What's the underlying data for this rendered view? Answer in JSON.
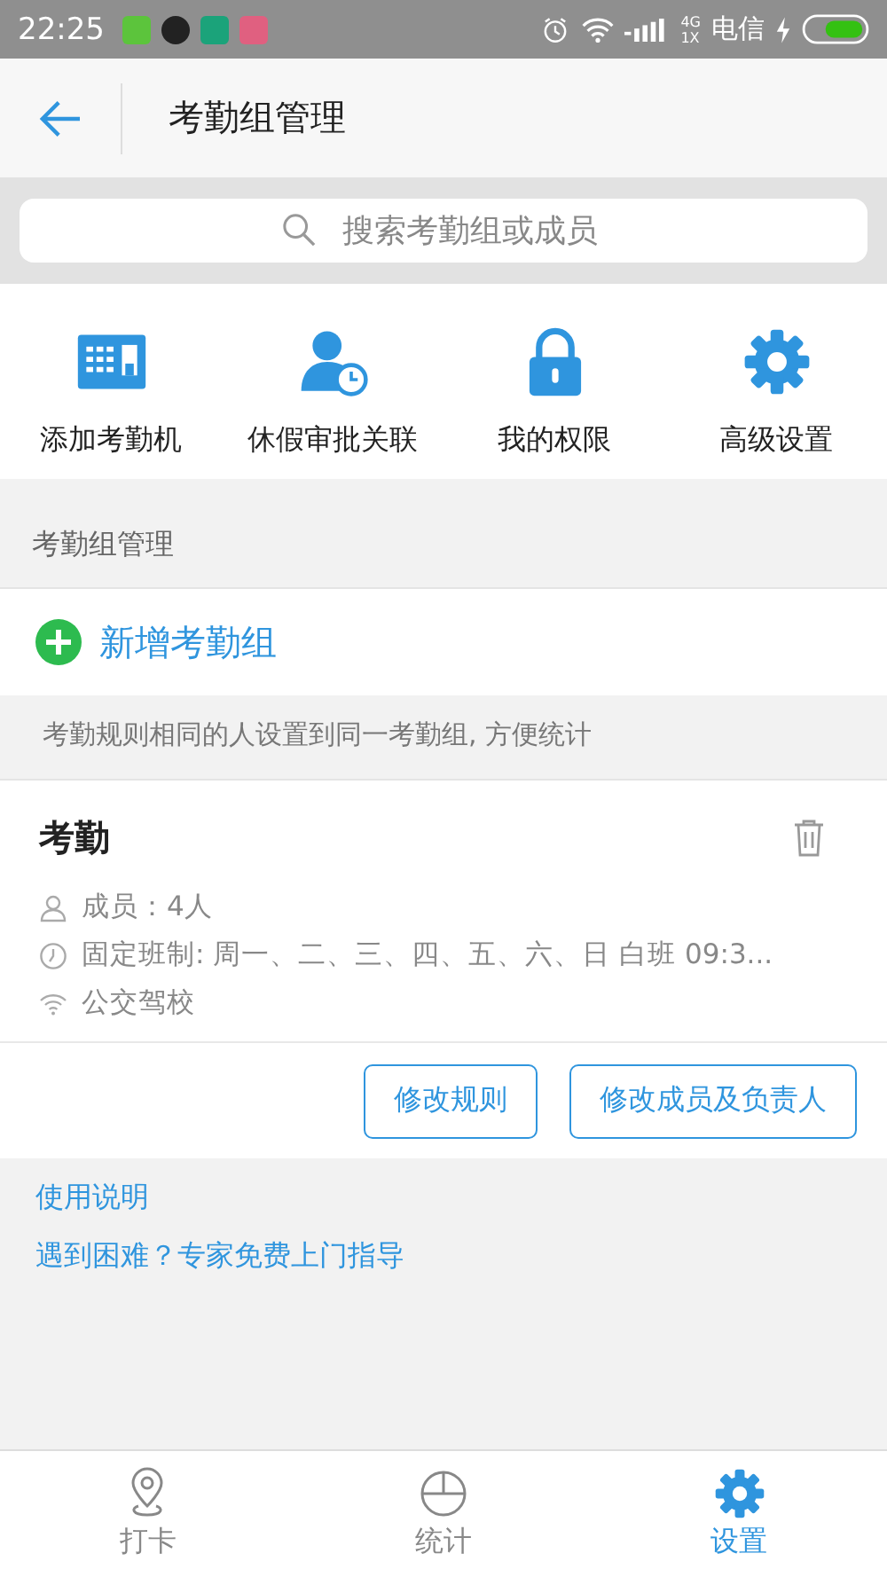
{
  "status_bar": {
    "time": "22:25",
    "network": [
      "4G",
      "1X"
    ],
    "carrier": "电信"
  },
  "header": {
    "title": "考勤组管理"
  },
  "search": {
    "placeholder": "搜索考勤组或成员"
  },
  "shortcuts": [
    {
      "kind": "device",
      "label": "添加考勤机"
    },
    {
      "kind": "person-clock",
      "label": "休假审批关联"
    },
    {
      "kind": "lock",
      "label": "我的权限"
    },
    {
      "kind": "gear",
      "label": "高级设置"
    }
  ],
  "section_title": "考勤组管理",
  "add_group": {
    "label": "新增考勤组"
  },
  "hint": "考勤规则相同的人设置到同一考勤组, 方便统计",
  "group": {
    "name": "考勤",
    "details": [
      {
        "kind": "members",
        "text": "成员：4人"
      },
      {
        "kind": "schedule",
        "text": "固定班制: 周一、二、三、四、五、六、日 白班 09:3..."
      },
      {
        "kind": "wifi",
        "text": "公交驾校"
      }
    ],
    "buttons": [
      "修改规则",
      "修改成员及负责人"
    ]
  },
  "links": [
    "使用说明",
    "遇到困难？专家免费上门指导"
  ],
  "tabs": [
    {
      "kind": "pin",
      "label": "打卡",
      "selected": false
    },
    {
      "kind": "chart",
      "label": "统计",
      "selected": false
    },
    {
      "kind": "gear",
      "label": "设置",
      "selected": true
    }
  ]
}
